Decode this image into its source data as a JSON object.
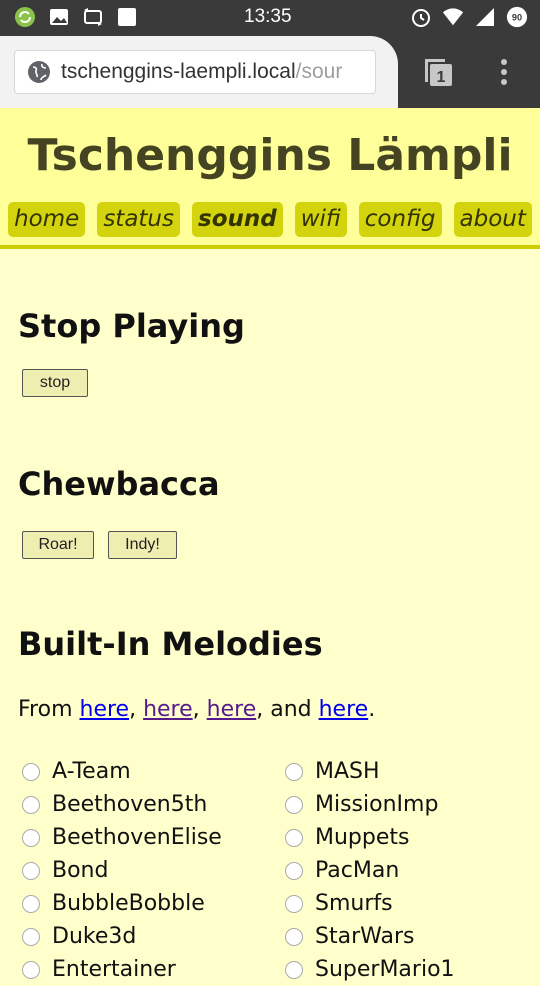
{
  "statusbar": {
    "time": "13:35",
    "battery_level": "90"
  },
  "browser": {
    "url_host": "tschenggins-laempli.local",
    "url_path": "/sour",
    "tab_count": "1"
  },
  "header": {
    "title": "Tschenggins Lämpli",
    "nav": [
      "home",
      "status",
      "sound",
      "wifi",
      "config",
      "about"
    ],
    "active_nav": "sound"
  },
  "sections": {
    "stop": {
      "heading": "Stop Playing",
      "button": "stop"
    },
    "chewbacca": {
      "heading": "Chewbacca",
      "buttons": [
        "Roar!",
        "Indy!"
      ]
    },
    "melodies": {
      "heading": "Built-In Melodies",
      "from_prefix": "From ",
      "links": [
        "here",
        "here",
        "here",
        "here"
      ],
      "sep1": ", ",
      "sep2": ", ",
      "sep3": ", and ",
      "end": ".",
      "col1": [
        "A-Team",
        "Beethoven5th",
        "BeethovenElise",
        "Bond",
        "BubbleBobble",
        "Duke3d",
        "Entertainer"
      ],
      "col2": [
        "MASH",
        "MissionImp",
        "Muppets",
        "PacMan",
        "Smurfs",
        "StarWars",
        "SuperMario1"
      ]
    }
  },
  "colors": {
    "page_bg": "#ffffcc",
    "header_bg": "#ffff99",
    "nav_bg": "#d4d40e"
  }
}
